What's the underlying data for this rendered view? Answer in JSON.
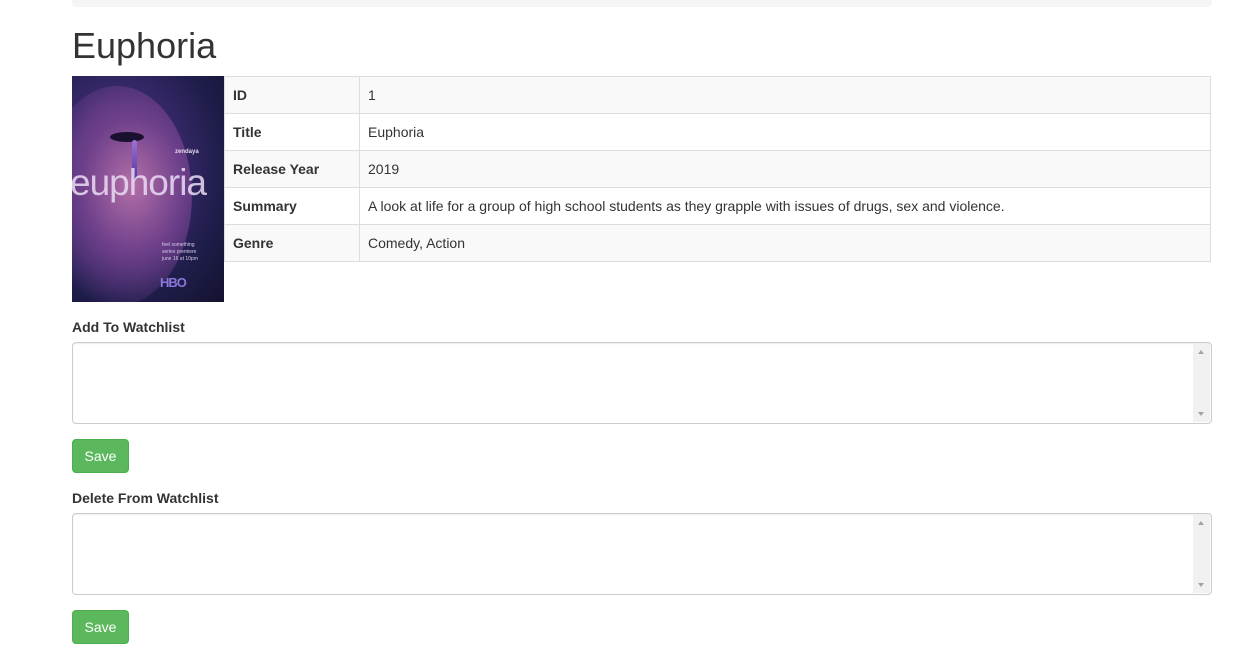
{
  "page": {
    "title": "Euphoria"
  },
  "poster": {
    "credit": "zendaya",
    "wordmark": "euphoria",
    "tagline_lines": [
      "feel something",
      "series premiere",
      "june 16 at 10pm"
    ],
    "network": "HBO"
  },
  "details": [
    {
      "label": "ID",
      "value": "1"
    },
    {
      "label": "Title",
      "value": "Euphoria"
    },
    {
      "label": "Release Year",
      "value": "2019"
    },
    {
      "label": "Summary",
      "value": "A look at life for a group of high school students as they grapple with issues of drugs, sex and violence."
    },
    {
      "label": "Genre",
      "value": "Comedy, Action"
    }
  ],
  "add_watchlist": {
    "label": "Add To Watchlist",
    "value": "",
    "save_label": "Save"
  },
  "delete_watchlist": {
    "label": "Delete From Watchlist",
    "value": "",
    "save_label": "Save"
  },
  "colors": {
    "save_button": "#5cb85c",
    "table_stripe": "#f9f9f9",
    "border": "#dddddd"
  }
}
